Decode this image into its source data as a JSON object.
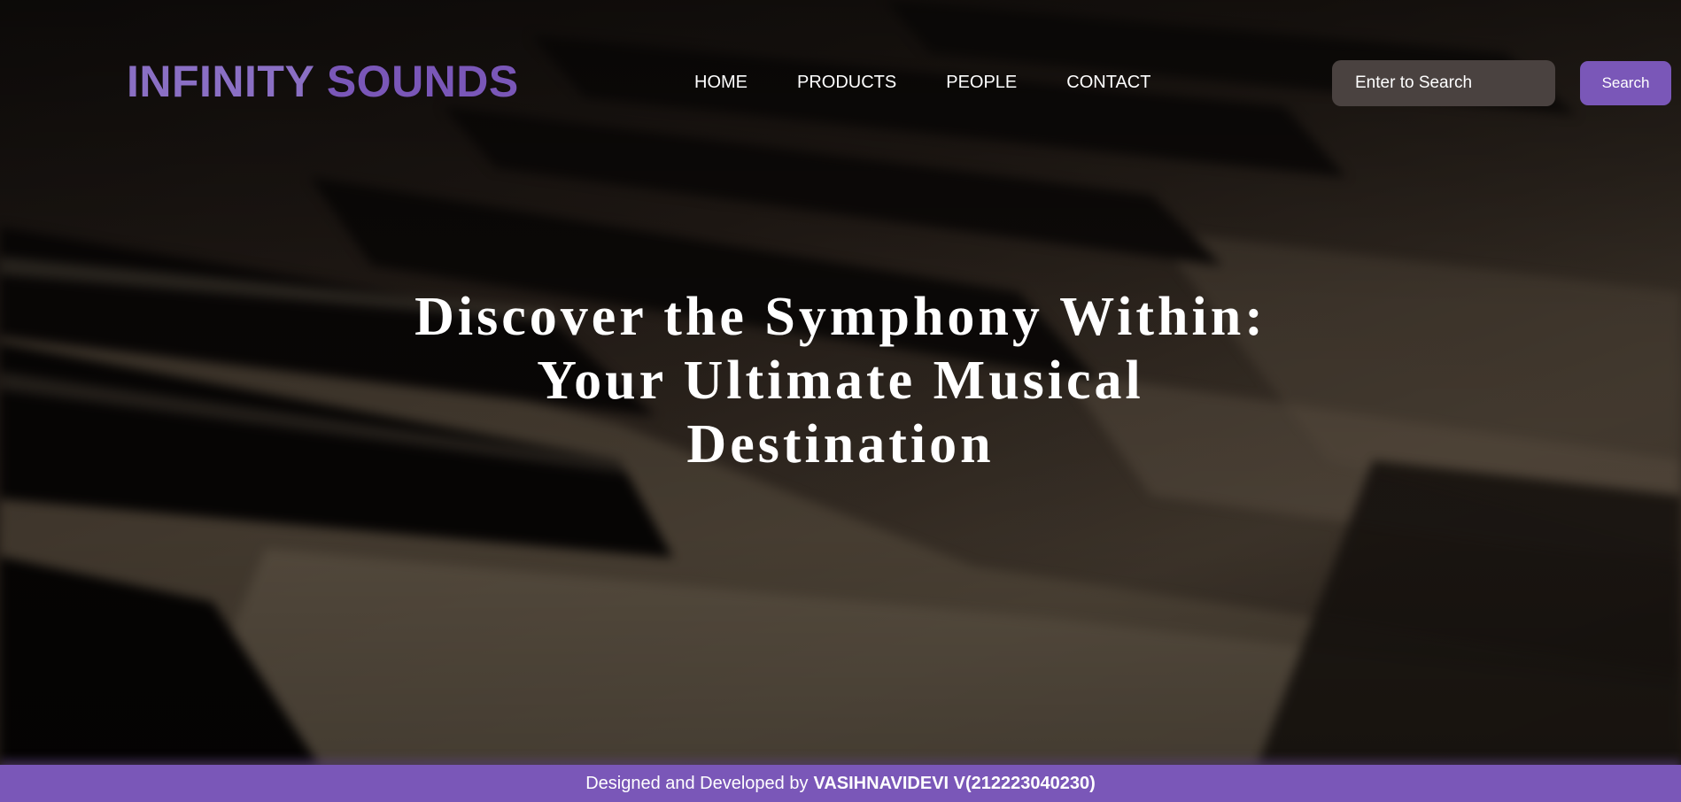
{
  "brand": {
    "word1": "INFINITY",
    "word2": "SOUNDS",
    "color_word1": "#8a6fc4",
    "color_word2": "#7a57b8"
  },
  "nav": {
    "items": [
      {
        "label": "HOME"
      },
      {
        "label": "PRODUCTS"
      },
      {
        "label": "PEOPLE"
      },
      {
        "label": "CONTACT"
      }
    ]
  },
  "search": {
    "placeholder": "Enter to Search",
    "value": "",
    "button_label": "Search"
  },
  "hero": {
    "headline": "Discover the Symphony Within: Your Ultimate Musical Destination",
    "background_image": "piano-keys"
  },
  "footer": {
    "prefix": "Designed and Developed by",
    "author": "VASIHNAVIDEVI V(212223040230)"
  },
  "colors": {
    "accent": "#7a57b8",
    "search_field": "#4a4240",
    "text": "#ffffff"
  }
}
